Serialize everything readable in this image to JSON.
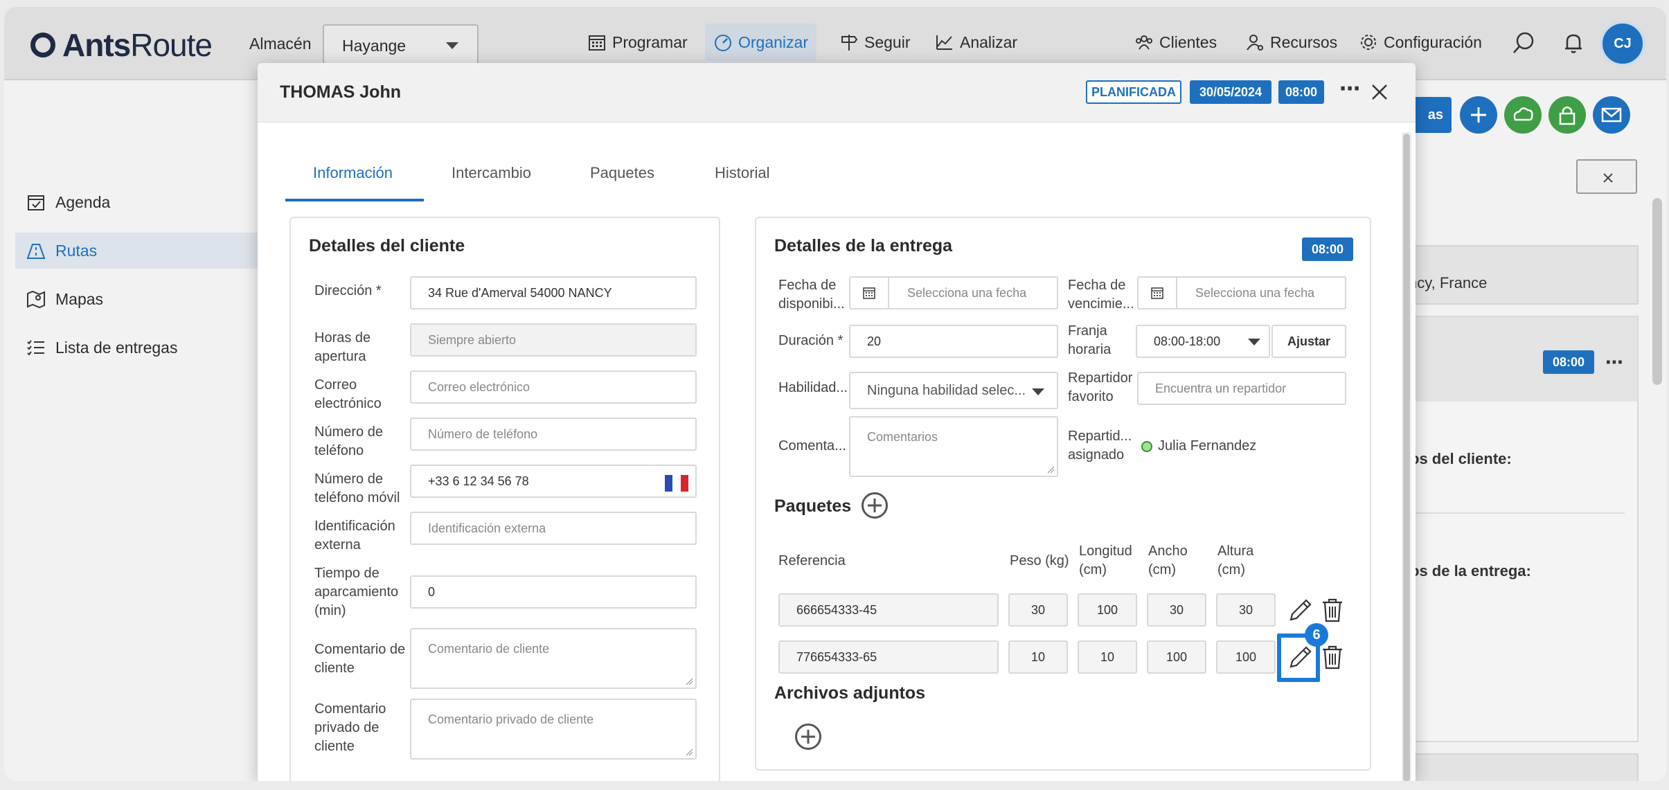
{
  "topnav": {
    "logo_bold": "Ants",
    "logo_light": "Route",
    "warehouse_label": "Almacén",
    "warehouse_value": "Hayange",
    "items": [
      {
        "label": "Programar",
        "icon": "calendar-icon"
      },
      {
        "label": "Organizar",
        "icon": "gauge-icon"
      },
      {
        "label": "Seguir",
        "icon": "signpost-icon"
      },
      {
        "label": "Analizar",
        "icon": "chart-icon"
      },
      {
        "label": "Clientes",
        "icon": "clients-icon"
      },
      {
        "label": "Recursos",
        "icon": "resources-icon"
      },
      {
        "label": "Configuración",
        "icon": "gear-icon"
      }
    ],
    "avatar": "CJ"
  },
  "sidebar": {
    "items": [
      {
        "label": "Agenda",
        "icon": "calendar-check-icon"
      },
      {
        "label": "Rutas",
        "icon": "route-icon"
      },
      {
        "label": "Mapas",
        "icon": "map-icon"
      },
      {
        "label": "Lista de entregas",
        "icon": "list-icon"
      }
    ]
  },
  "background": {
    "address_fragment": "ncy, France",
    "time_badge": "08:00",
    "client_data_label": "os del cliente:",
    "delivery_data_label": "os de la entrega:",
    "button_fragment": "as"
  },
  "modal": {
    "title": "THOMAS John",
    "status": "PLANIFICADA",
    "date": "30/05/2024",
    "time": "08:00",
    "tabs": [
      "Información",
      "Intercambio",
      "Paquetes",
      "Historial"
    ],
    "client": {
      "title": "Detalles del cliente",
      "address_label": "Dirección *",
      "address_value": "34 Rue d'Amerval 54000 NANCY",
      "hours_label": "Horas de apertura",
      "hours_placeholder": "Siempre abierto",
      "email_label": "Correo electrónico",
      "email_placeholder": "Correo electrónico",
      "phone_label": "Número de teléfono",
      "phone_placeholder": "Número de teléfono",
      "mobile_label": "Número de teléfono móvil",
      "mobile_value": "+33 6 12 34 56 78",
      "external_id_label": "Identificación externa",
      "external_id_placeholder": "Identificación externa",
      "parking_label": "Tiempo de aparcamiento (min)",
      "parking_value": "0",
      "comment_label": "Comentario de cliente",
      "comment_placeholder": "Comentario de cliente",
      "private_comment_label": "Comentario privado de cliente",
      "private_comment_placeholder": "Comentario privado de cliente"
    },
    "delivery": {
      "title": "Detalles de la entrega",
      "time_badge": "08:00",
      "availability_label": "Fecha de disponibi...",
      "availability_placeholder": "Selecciona una fecha",
      "expiry_label": "Fecha de vencimie...",
      "expiry_placeholder": "Selecciona una fecha",
      "duration_label": "Duración *",
      "duration_value": "20",
      "slot_label": "Franja horaria",
      "slot_value": "08:00-18:00",
      "adjust_button": "Ajustar",
      "skills_label": "Habilidad...",
      "skills_value": "Ninguna habilidad selec...",
      "fav_driver_label": "Repartidor favorito",
      "fav_driver_placeholder": "Encuentra un repartidor",
      "comments_label": "Comenta...",
      "comments_placeholder": "Comentarios",
      "assigned_label": "Repartid... asignado",
      "assigned_value": "Julia Fernandez",
      "packages_title": "Paquetes",
      "columns": [
        "Referencia",
        "Peso (kg)",
        "Longitud (cm)",
        "Ancho (cm)",
        "Altura (cm)"
      ],
      "packages": [
        {
          "ref": "666654333-45",
          "weight": "30",
          "length": "100",
          "width": "30",
          "height": "30"
        },
        {
          "ref": "776654333-65",
          "weight": "10",
          "length": "10",
          "width": "100",
          "height": "100"
        }
      ],
      "attachments_title": "Archivos adjuntos",
      "step_badge": "6"
    }
  }
}
